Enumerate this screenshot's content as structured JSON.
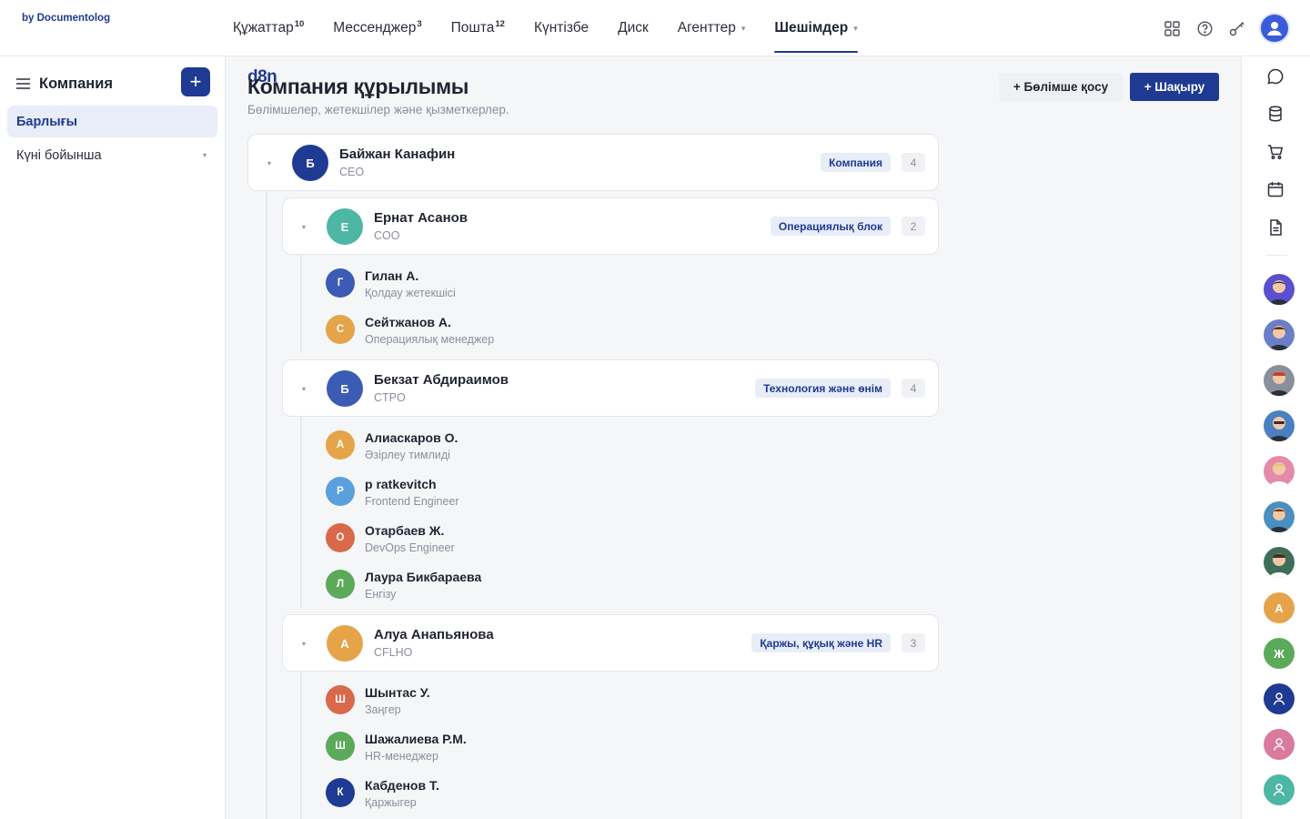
{
  "logo": {
    "main": "d8n",
    "sub": "by Documentolog"
  },
  "nav": [
    {
      "label": "Құжаттар",
      "badge": "10"
    },
    {
      "label": "Мессенджер",
      "badge": "3"
    },
    {
      "label": "Пошта",
      "badge": "12"
    },
    {
      "label": "Күнтізбе",
      "badge": ""
    },
    {
      "label": "Диск",
      "badge": ""
    },
    {
      "label": "Агенттер",
      "badge": ""
    },
    {
      "label": "Шешімдер",
      "badge": ""
    }
  ],
  "sidebar": {
    "title": "Компания",
    "add_label": "+",
    "items": [
      {
        "label": "Барлығы"
      },
      {
        "label": "Күні бойынша"
      }
    ]
  },
  "page": {
    "title": "Компания құрылымы",
    "subtitle": "Бөлімшелер, жетекшілер және қызметкерлер.",
    "add_unit_label": "+ Бөлімше қосу",
    "invite_label": "+ Шақыру"
  },
  "root": {
    "initial": "Б",
    "name": "Байжан Канафин",
    "role": "CEO",
    "tag": "Компания",
    "count": "4",
    "color": "#1f3a93"
  },
  "groups": [
    {
      "initial": "Е",
      "name": "Ернат Асанов",
      "role": "COO",
      "tag": "Операциялық блок",
      "count": "2",
      "color": "#4db6a5",
      "employees": [
        {
          "initial": "Г",
          "name": "Гилан А.",
          "role": "Қолдау жетекшісі",
          "color": "#3b5bb5"
        },
        {
          "initial": "С",
          "name": "Сейтжанов А.",
          "role": "Операциялық менеджер",
          "color": "#e5a44a"
        }
      ]
    },
    {
      "initial": "Б",
      "name": "Бекзат Абдираимов",
      "role": "CTPO",
      "tag": "Технология және өнім",
      "count": "4",
      "color": "#3b5bb5",
      "employees": [
        {
          "initial": "А",
          "name": "Алиаскаров О.",
          "role": "Әзірлеу тимлиді",
          "color": "#e5a44a"
        },
        {
          "initial": "Р",
          "name": "р ratkevitch",
          "role": "Frontend Engineer",
          "color": "#5aa0dc"
        },
        {
          "initial": "О",
          "name": "Отарбаев Ж.",
          "role": "DevOps Engineer",
          "color": "#d9694a"
        },
        {
          "initial": "Л",
          "name": "Лаура Бикбараева",
          "role": "Енгізу",
          "color": "#5aaa5a"
        }
      ]
    },
    {
      "initial": "А",
      "name": "Алуа Анапьянова",
      "role": "CFLHO",
      "tag": "Қаржы, құқық және HR",
      "count": "3",
      "color": "#e5a44a",
      "employees": [
        {
          "initial": "Ш",
          "name": "Шынтас У.",
          "role": "Заңгер",
          "color": "#d9694a"
        },
        {
          "initial": "Ш",
          "name": "Шажалиева Р.М.",
          "role": "HR-менеджер",
          "color": "#5aaa5a"
        },
        {
          "initial": "К",
          "name": "Кабденов Т.",
          "role": "Қаржыгер",
          "color": "#1f3a93"
        }
      ]
    }
  ],
  "rail": {
    "contacts": [
      {
        "initial": "",
        "color": "#5a4fcf"
      },
      {
        "initial": "",
        "color": "#6b7fc9"
      },
      {
        "initial": "",
        "color": "#8a8f9c"
      },
      {
        "initial": "",
        "color": "#4a7fc1"
      },
      {
        "initial": "",
        "color": "#e58aa8"
      },
      {
        "initial": "",
        "color": "#4a8fbf"
      },
      {
        "initial": "",
        "color": "#3e6e5a"
      },
      {
        "initial": "А",
        "color": "#e5a44a"
      },
      {
        "initial": "Ж",
        "color": "#5aaa5a"
      },
      {
        "initial": "",
        "color": "#1f3a93"
      },
      {
        "initial": "",
        "color": "#d97a9e"
      },
      {
        "initial": "",
        "color": "#4db6a5"
      }
    ]
  }
}
